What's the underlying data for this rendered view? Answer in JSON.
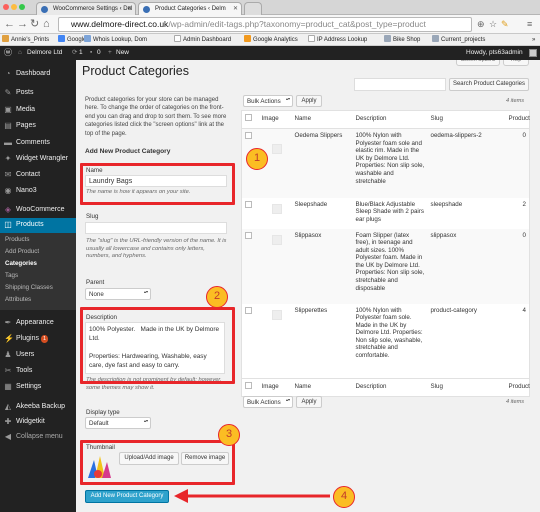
{
  "browser": {
    "tabs": [
      {
        "label": "WooCommerce Settings ‹ Del",
        "active": false
      },
      {
        "label": "Product Categories ‹ Delm",
        "active": true
      }
    ],
    "url_host": "www.delmore-direct.co.uk",
    "url_path": "/wp-admin/edit-tags.php?taxonomy=product_cat&post_type=product",
    "bookmarks": [
      "Annie's_Prints",
      "Google",
      "Whois Lookup, Dom",
      "Admin Dashboard",
      "Google Analytics",
      "IP Address Lookup",
      "Bike Shop",
      "Current_projects"
    ]
  },
  "adminbar": {
    "site_name": "Delmore Ltd",
    "updates_count": "1",
    "comments_count": "0",
    "new_label": "New",
    "howdy": "Howdy, pts63admin"
  },
  "sidebar": {
    "items": [
      {
        "label": "Dashboard",
        "icon": "dashboard-icon"
      },
      {
        "label": "Posts",
        "icon": "pin-icon"
      },
      {
        "label": "Media",
        "icon": "media-icon"
      },
      {
        "label": "Pages",
        "icon": "page-icon"
      },
      {
        "label": "Comments",
        "icon": "comment-icon"
      },
      {
        "label": "Widget Wrangler",
        "icon": "widget-icon"
      },
      {
        "label": "Contact",
        "icon": "mail-icon"
      },
      {
        "label": "Nano3",
        "icon": "nano-icon"
      },
      {
        "label": "WooCommerce",
        "icon": "woocommerce-icon"
      },
      {
        "label": "Products",
        "icon": "products-icon"
      }
    ],
    "submenu": [
      "Products",
      "Add Product",
      "Categories",
      "Tags",
      "Shipping Classes",
      "Attributes"
    ],
    "lower": [
      {
        "label": "Appearance",
        "icon": "brush-icon"
      },
      {
        "label": "Plugins",
        "icon": "plug-icon",
        "badge": "1"
      },
      {
        "label": "Users",
        "icon": "users-icon"
      },
      {
        "label": "Tools",
        "icon": "wrench-icon"
      },
      {
        "label": "Settings",
        "icon": "settings-icon"
      },
      {
        "label": "Akeeba Backup",
        "icon": "akeeba-icon"
      },
      {
        "label": "Widgetkit",
        "icon": "widgetkit-icon"
      },
      {
        "label": "Collapse menu",
        "icon": "collapse-icon"
      }
    ]
  },
  "page": {
    "title": "Product Categories",
    "screen_options": "Screen Options",
    "help": "Help",
    "search_button": "Search Product Categories",
    "intro": "Product categories for your store can be managed here. To change the order of categories on the front-end you can drag and drop to sort them. To see more categories listed click the \"screen options\" link at the top of the page.",
    "form": {
      "heading": "Add New Product Category",
      "name_label": "Name",
      "name_value": "Laundry Bags",
      "name_help": "The name is how it appears on your site.",
      "slug_label": "Slug",
      "slug_value": "",
      "slug_help": "The \"slug\" is the URL-friendly version of the name. It is usually all lowercase and contains only letters, numbers, and hyphens.",
      "parent_label": "Parent",
      "parent_value": "None",
      "description_label": "Description",
      "description_value": "100% Polyester.   Made in the UK by Delmore Ltd.\n\nProperties: Hardwearing, Washable, easy care, dye fast and easy to carry.",
      "description_help": "The description is not prominent by default; however, some themes may show it.",
      "display_type_label": "Display type",
      "display_type_value": "Default",
      "thumbnail_label": "Thumbnail",
      "upload_button": "Upload/Add image",
      "remove_button": "Remove image",
      "submit_button": "Add New Product Category"
    },
    "bulk_actions": "Bulk Actions",
    "apply": "Apply",
    "items_count": "4 items",
    "table": {
      "columns": [
        "Image",
        "Name",
        "Description",
        "Slug",
        "Product"
      ],
      "rows": [
        {
          "name": "Oedema Slippers",
          "description": "100% Nylon with Polyester foam sole and elastic rim. Made in the UK by Delmore Ltd. Properties: Non slip sole, washable and stretchable",
          "slug": "oedema-slippers-2",
          "count": "0"
        },
        {
          "name": "Sleepshade",
          "description": "Blue/Black Adjustable Sleep Shade with 2 pairs ear plugs",
          "slug": "sleepshade",
          "count": "2"
        },
        {
          "name": "Slippasox",
          "description": "Foam Slipper (latex free), in teenage and adult sizes. 100% Polyester foam. Made in the UK by Delmore Ltd. Properties: Non slip sole, stretchable and disposable",
          "slug": "slippasox",
          "count": "0"
        },
        {
          "name": "Slipperettes",
          "description": "100% Nylon with Polyester foam sole. Made in the UK by Delmore Ltd. Properties: Non slip sole, washable, stretchable and comfortable.",
          "slug": "product-category",
          "count": "4"
        }
      ]
    }
  },
  "annotations": [
    "1",
    "2",
    "3",
    "4"
  ],
  "colors": {
    "accent": "#0074a2",
    "highlight": "#e8262a",
    "callout": "#fbbd23",
    "primary_button": "#2ea2cc"
  }
}
